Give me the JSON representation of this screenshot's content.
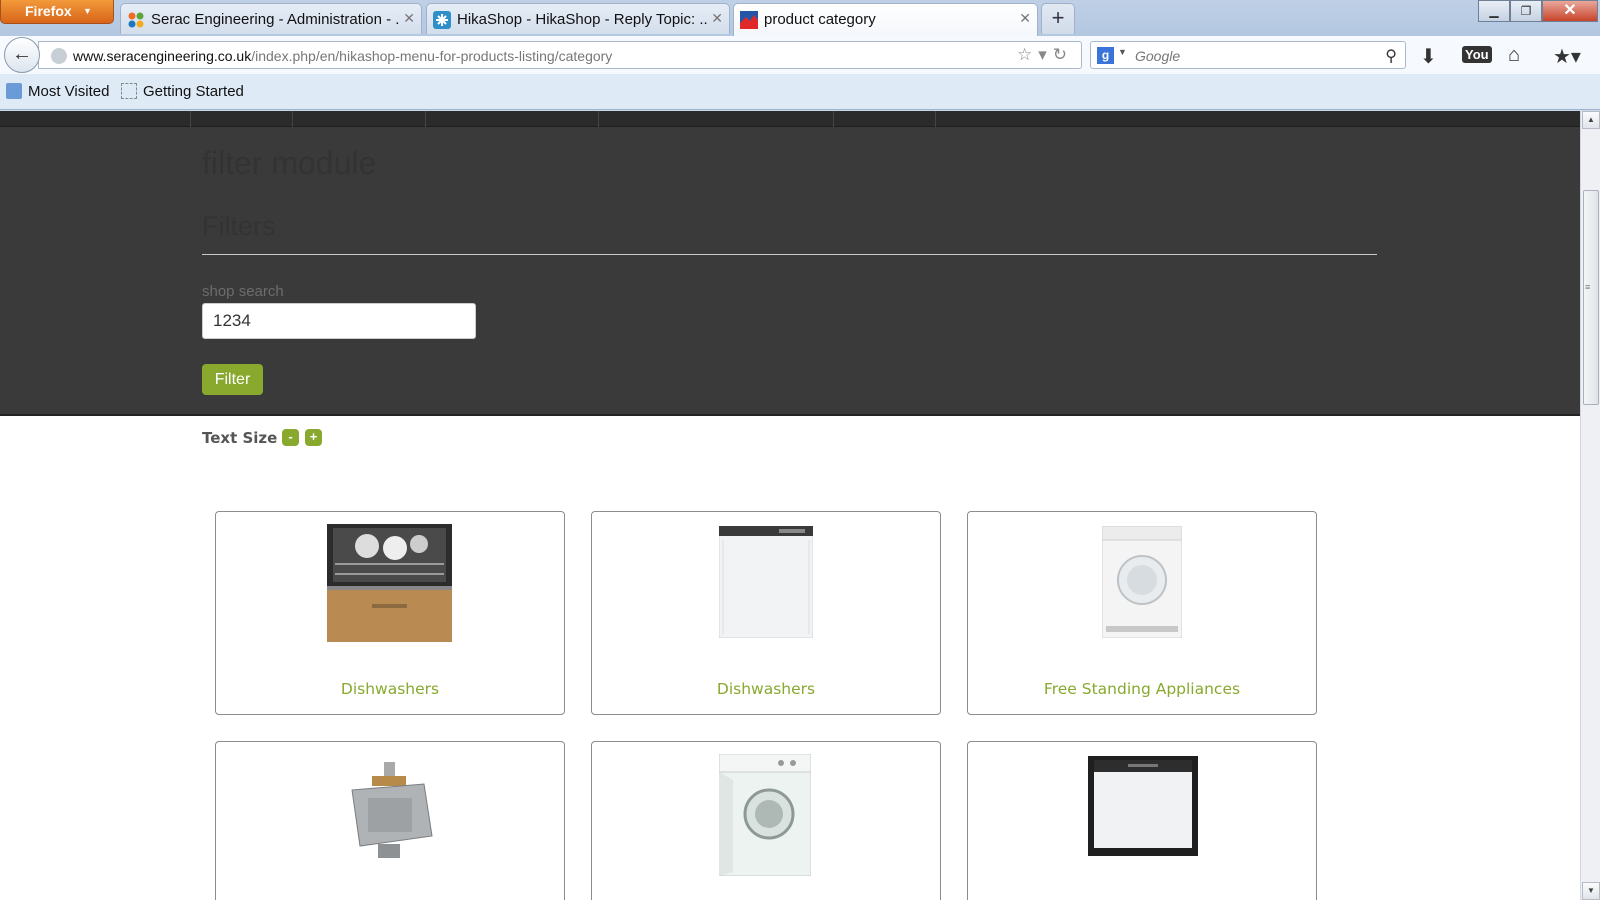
{
  "browser": {
    "app_button": "Firefox",
    "tabs": [
      {
        "title": "Serac Engineering - Administration - ...",
        "active": false
      },
      {
        "title": "HikaShop - HikaShop - Reply Topic: ...",
        "active": false
      },
      {
        "title": "product category",
        "active": true
      }
    ],
    "new_tab": "+",
    "url_domain": "www.seracengineering.co.uk",
    "url_path": "/index.php/en/hikashop-menu-for-products-listing/category",
    "search_placeholder": "Google",
    "bookmarks": [
      "Most Visited",
      "Getting Started"
    ]
  },
  "page": {
    "module_title": "filter module",
    "filters_heading": "Filters",
    "search_label": "shop search",
    "search_value": "1234",
    "filter_button": "Filter",
    "text_size_label": "Text Size",
    "text_size_minus": "-",
    "text_size_plus": "+",
    "categories": [
      {
        "name": "Dishwashers",
        "image": "built-in-dishwasher-open"
      },
      {
        "name": "Dishwashers",
        "image": "semi-integrated-dishwasher"
      },
      {
        "name": "Free Standing Appliances",
        "image": "tumble-dryer"
      },
      {
        "name": "",
        "image": "microwave-magnetron"
      },
      {
        "name": "",
        "image": "integrated-washing-machine"
      },
      {
        "name": "",
        "image": "integrated-dishwasher"
      }
    ]
  },
  "colors": {
    "accent_green": "#88a92e",
    "dark_band": "#3a3a3a"
  }
}
